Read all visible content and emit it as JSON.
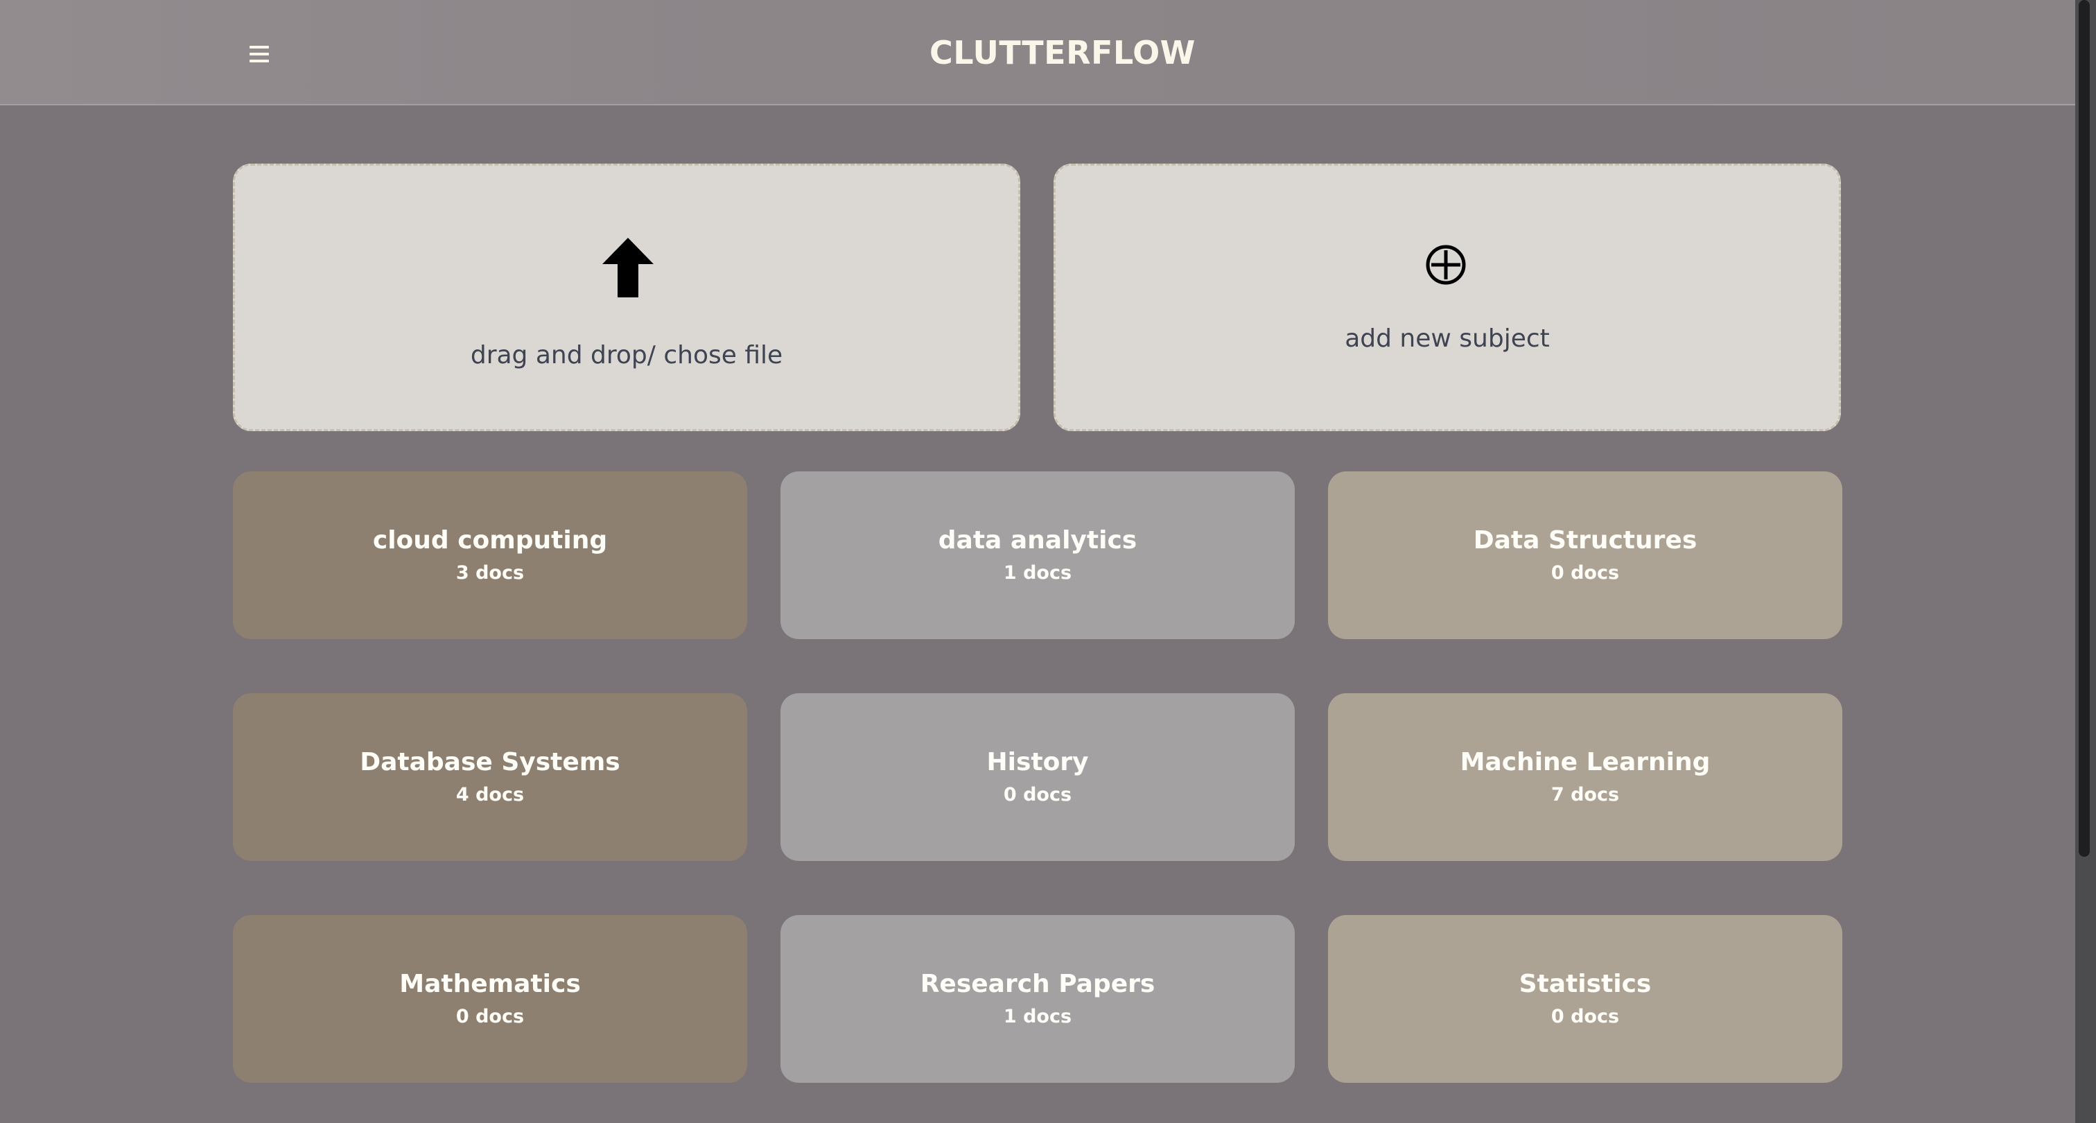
{
  "header": {
    "title": "CLUTTERFLOW"
  },
  "actions": {
    "upload_label": "drag and drop/ chose file",
    "add_subject_label": "add new subject"
  },
  "colors": {
    "background": "#7a7378",
    "header": "#8c8689",
    "action_card": "#dbd8d3",
    "subject_brown": "#8d8070",
    "subject_gray": "#a3a1a2",
    "subject_beige": "#ada394",
    "title_cream": "#fbf6ea"
  },
  "icons": {
    "menu": "menu-icon",
    "upload": "upload-arrow-icon",
    "add": "add-circle-icon"
  },
  "subjects": [
    {
      "name": "cloud computing",
      "count": "3 docs",
      "color": "#8d8070"
    },
    {
      "name": "data analytics",
      "count": "1 docs",
      "color": "#a3a1a2"
    },
    {
      "name": "Data Structures",
      "count": "0 docs",
      "color": "#ada394"
    },
    {
      "name": "Database Systems",
      "count": "4 docs",
      "color": "#8d8070"
    },
    {
      "name": "History",
      "count": "0 docs",
      "color": "#a3a1a2"
    },
    {
      "name": "Machine Learning",
      "count": "7 docs",
      "color": "#ada394"
    },
    {
      "name": "Mathematics",
      "count": "0 docs",
      "color": "#8d8070"
    },
    {
      "name": "Research Papers",
      "count": "1 docs",
      "color": "#a3a1a2"
    },
    {
      "name": "Statistics",
      "count": "0 docs",
      "color": "#ada394"
    }
  ]
}
